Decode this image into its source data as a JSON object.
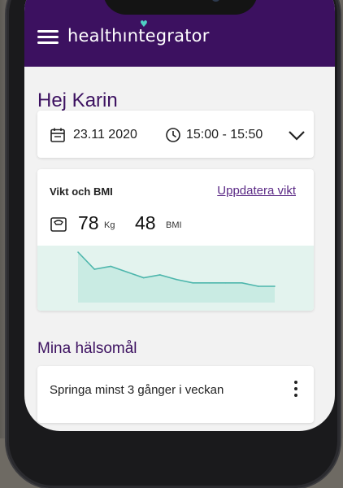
{
  "header": {
    "logo_text": "healthıntegrator",
    "logo_accent": "#4fd1c5",
    "background": "#3c1160"
  },
  "greeting": "Hej Karin",
  "appointment": {
    "date": "23.11 2020",
    "time": "15:00 - 15:50"
  },
  "weight_card": {
    "title": "Vikt och BMI",
    "update_link": "Uppdatera vikt",
    "weight_value": "78",
    "weight_unit": "Kg",
    "bmi_value": "48",
    "bmi_unit": "BMI",
    "chart_data": {
      "type": "area",
      "values": [
        84,
        81,
        81.5,
        80.5,
        79.5,
        80,
        79.2,
        78.6,
        78.6,
        78.6,
        78.6,
        78.0,
        78.0
      ],
      "line_color": "#4db6ac",
      "fill_color": "#c9ebe3"
    }
  },
  "goals": {
    "title": "Mina hälsomål",
    "items": [
      {
        "text": "Springa minst 3 gånger i veckan"
      }
    ]
  },
  "icons": {
    "menu": "hamburger-icon",
    "calendar": "calendar-icon",
    "clock": "clock-icon",
    "expand": "chevron-down-icon",
    "scale": "scale-icon",
    "more": "kebab-icon"
  }
}
